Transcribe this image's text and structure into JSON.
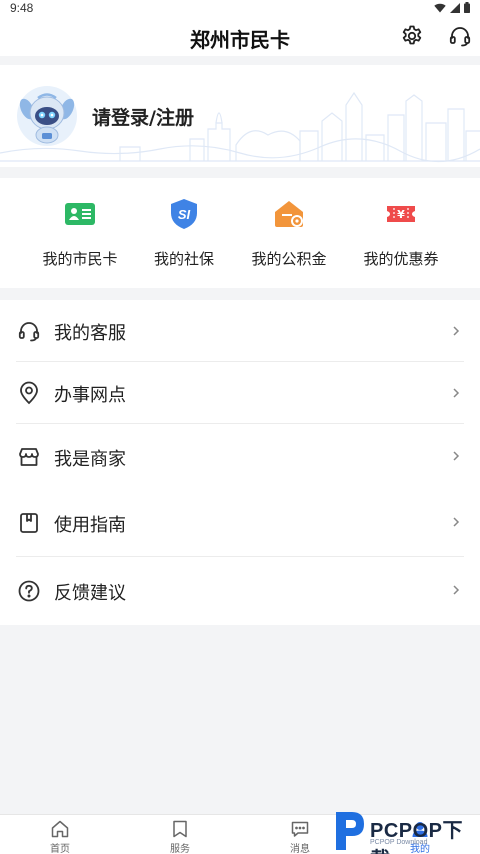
{
  "status_bar": {
    "time": "9:48"
  },
  "header": {
    "title": "郑州市民卡"
  },
  "profile": {
    "login_label": "请登录/注册"
  },
  "quick_actions": [
    {
      "label": "我的市民卡",
      "icon": "id-card-icon",
      "color": "#2db865"
    },
    {
      "label": "我的社保",
      "icon": "social-security-shield-icon",
      "color": "#3f83e5"
    },
    {
      "label": "我的公积金",
      "icon": "housing-fund-icon",
      "color": "#f2953b"
    },
    {
      "label": "我的优惠券",
      "icon": "coupon-ticket-icon",
      "color": "#ef4b4b"
    }
  ],
  "menu": [
    {
      "label": "我的客服",
      "icon": "headset-icon"
    },
    {
      "label": "办事网点",
      "icon": "location-pin-icon"
    },
    {
      "label": "我是商家",
      "icon": "storefront-icon"
    },
    {
      "label": "使用指南",
      "icon": "guide-book-icon"
    },
    {
      "label": "反馈建议",
      "icon": "question-circle-icon"
    }
  ],
  "bottom_nav": [
    {
      "label": "首页",
      "icon": "home-icon",
      "active": false
    },
    {
      "label": "服务",
      "icon": "bookmark-icon",
      "active": false
    },
    {
      "label": "消息",
      "icon": "message-icon",
      "active": false
    },
    {
      "label": "我的",
      "icon": "profile-icon",
      "active": true
    }
  ],
  "watermark": {
    "brand": "PCPOP下载",
    "subtitle": "PCPOP Download"
  }
}
